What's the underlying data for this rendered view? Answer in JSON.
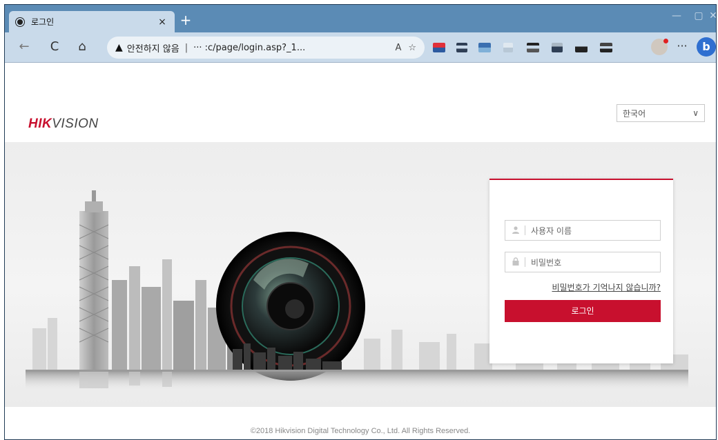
{
  "browser": {
    "tab_title": "로그인",
    "tab_close": "×",
    "new_tab": "+",
    "window_controls": {
      "minimize": "—",
      "maximize": "▢",
      "close": "✕"
    },
    "nav": {
      "back": "←",
      "refresh": "C",
      "home": "⌂"
    },
    "address": {
      "warning_icon": "warning-triangle-icon",
      "security_label": "안전하지 않음",
      "separator": "|",
      "url": "··· :c/page/login.asp?_1...",
      "read_aloud_icon": "A",
      "favorite_icon": "☆"
    },
    "more_label": "···",
    "bing_label": "b"
  },
  "page": {
    "logo_hik": "HIK",
    "logo_vision": "VISION",
    "language": {
      "selected": "한국어",
      "arrow": "∨"
    },
    "login": {
      "username_placeholder": "사용자 이름",
      "password_placeholder": "비밀번호",
      "forgot_link": "비밀번호가 기억나지 않습니까?",
      "button_label": "로그인"
    },
    "footer": "©2018 Hikvision Digital Technology Co., Ltd. All Rights Reserved."
  },
  "colors": {
    "brand_red": "#c8102e",
    "tabbar": "#5b8bb5",
    "toolbar": "#c9daea"
  }
}
